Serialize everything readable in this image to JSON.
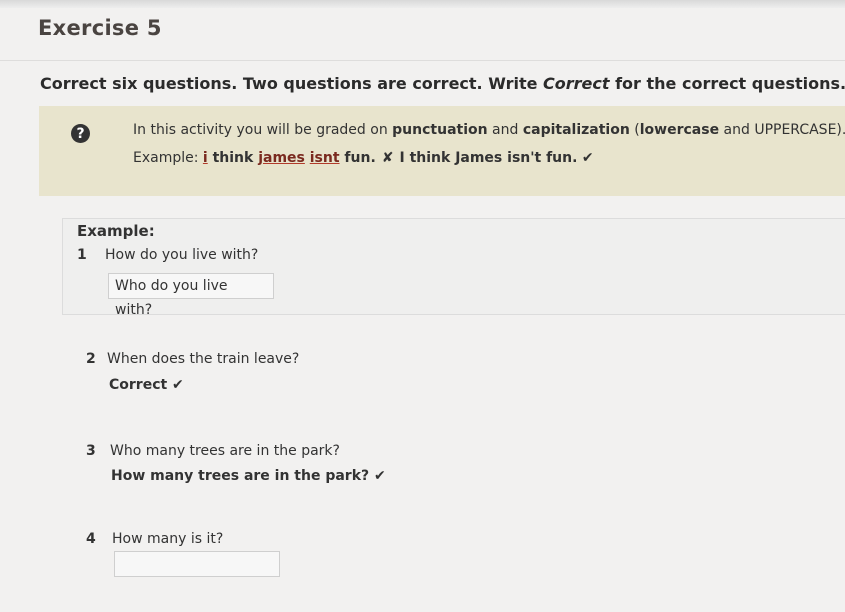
{
  "exercise": {
    "title": "Exercise 5",
    "instruction_main": "Correct six questions. Two questions are correct. Write ",
    "instruction_italic": "Correct",
    "instruction_end": " for the correct questions."
  },
  "info": {
    "icon": "question-icon",
    "icon_glyph": "?",
    "line1_a": "In this activity you will be graded on ",
    "line1_b": "punctuation",
    "line1_c": " and ",
    "line1_d": "capitalization",
    "line1_e": " (",
    "line1_f": "lowercase",
    "line1_g": " and UPPERCASE).",
    "example_label": "Example: ",
    "wrong_i": "i",
    "wrong_think": " think ",
    "wrong_james": "james",
    "wrong_space": " ",
    "wrong_isnt": "isnt",
    "wrong_fun": " fun.",
    "x_glyph": "✘",
    "right_sentence": "I think James isn't fun.",
    "tick_glyph": "✔"
  },
  "example": {
    "label": "Example:",
    "number": "1",
    "question": "How do you live with?",
    "answer": "Who do you live with?"
  },
  "questions": [
    {
      "number": "2",
      "text": "When does the train leave?",
      "answer": "Correct ✔"
    },
    {
      "number": "3",
      "text": "Who many trees are in the park?",
      "answer": "How many trees are in the park? ✔"
    },
    {
      "number": "4",
      "text": "How many is it?",
      "answer": ""
    }
  ]
}
